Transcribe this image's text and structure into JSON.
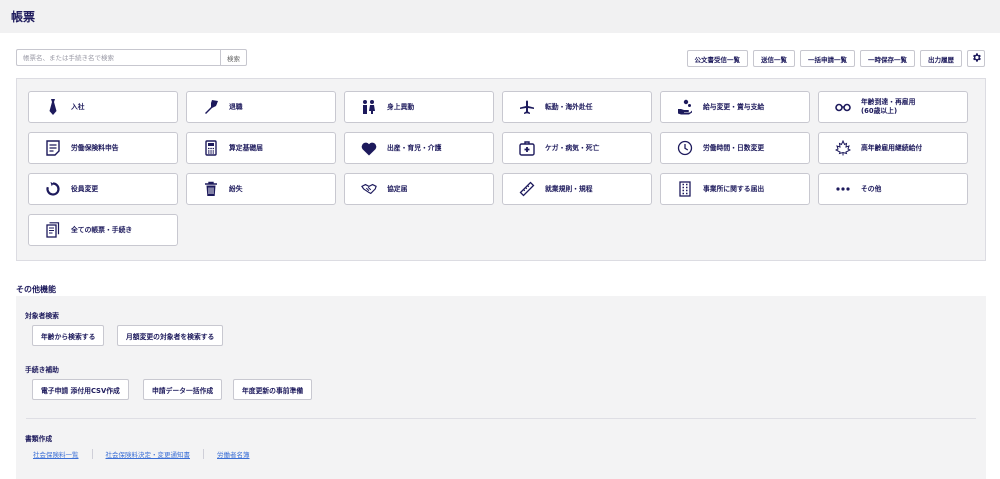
{
  "header": {
    "title": "帳票"
  },
  "search": {
    "placeholder": "帳票名、または手続き名で検索",
    "button_label": "検索"
  },
  "top_buttons": [
    "公文書受信一覧",
    "送信一覧",
    "一括申請一覧",
    "一時保存一覧",
    "出力履歴"
  ],
  "categories": [
    {
      "label": "入社",
      "icon": "necktie-icon"
    },
    {
      "label": "退職",
      "icon": "bouquet-icon"
    },
    {
      "label": "身上異動",
      "icon": "family-icon"
    },
    {
      "label": "転勤・海外赴任",
      "icon": "airplane-icon"
    },
    {
      "label": "給与変更・賞与支給",
      "icon": "money-hand-icon"
    },
    {
      "label": "年齢到達・再雇用",
      "label2": "(60歳以上)",
      "icon": "glasses-icon"
    },
    {
      "label": "労働保険料申告",
      "icon": "document-icon"
    },
    {
      "label": "算定基礎届",
      "icon": "calculator-icon"
    },
    {
      "label": "出産・育児・介護",
      "icon": "heart-icon"
    },
    {
      "label": "ケガ・病気・死亡",
      "icon": "first-aid-icon"
    },
    {
      "label": "労働時間・日数変更",
      "icon": "clock-icon"
    },
    {
      "label": "高年齢雇用継続給付",
      "icon": "maple-leaf-icon"
    },
    {
      "label": "役員変更",
      "icon": "refresh-icon"
    },
    {
      "label": "紛失",
      "icon": "trash-icon"
    },
    {
      "label": "協定届",
      "icon": "handshake-icon"
    },
    {
      "label": "就業規則・規程",
      "icon": "ruler-icon"
    },
    {
      "label": "事業所に関する届出",
      "icon": "building-icon"
    },
    {
      "label": "その他",
      "icon": "more-icon"
    },
    {
      "label": "全ての帳票・手続き",
      "icon": "documents-icon"
    }
  ],
  "other": {
    "title": "その他機能",
    "target_search": {
      "title": "対象者検索",
      "buttons": [
        "年齢から検索する",
        "月額変更の対象者を検索する"
      ]
    },
    "procedure_support": {
      "title": "手続き補助",
      "buttons": [
        "電子申請 添付用CSV作成",
        "申請データ一括作成",
        "年度更新の事前準備"
      ]
    },
    "document_creation": {
      "title": "書類作成",
      "links": [
        "社会保険料一覧",
        "社会保険料決定・変更通知書",
        "労働者名簿"
      ]
    }
  },
  "colors": {
    "accent": "#1d1a5c",
    "link": "#3b6fd6",
    "panel_bg": "#f3f3f4",
    "header_bg": "#f1f1f2"
  }
}
